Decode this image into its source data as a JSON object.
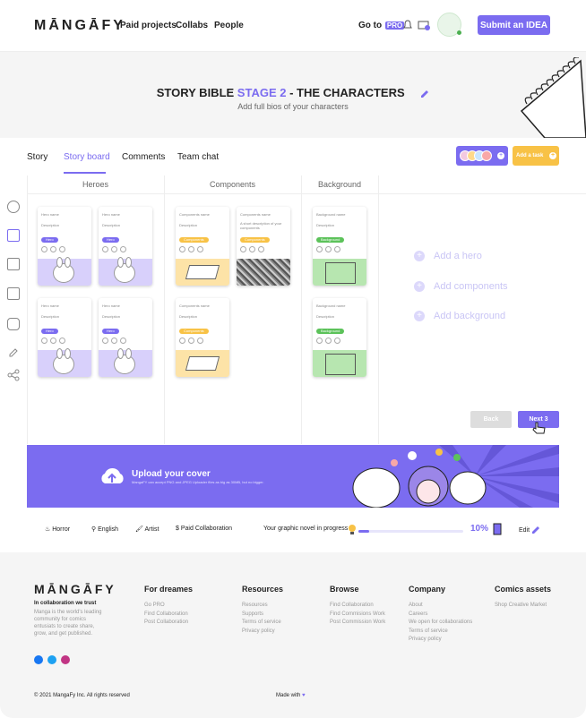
{
  "header": {
    "logo": "MĀNGĀFY",
    "nav": [
      "Paid projects",
      "Collabs",
      "People"
    ],
    "go_to": "Go to",
    "pro": "PRO",
    "submit": "Submit an IDEA"
  },
  "hero": {
    "title_a": "STORY BIBLE ",
    "title_stage": "STAGE 2",
    "title_b": " - THE CHARACTERS",
    "subtitle": "Add full bios of your characters"
  },
  "tabs": [
    "Story",
    "Story board",
    "Comments",
    "Team chat"
  ],
  "add_task": "Add a task",
  "board": {
    "columns": [
      "Heroes",
      "Components",
      "Background"
    ],
    "hero_card": {
      "name": "Hero name",
      "desc": "Description",
      "badge": "Hero"
    },
    "comp_card": {
      "name": "Components name",
      "desc": "Description",
      "desc2": "A short description of your components",
      "badge": "Components"
    },
    "bg_card": {
      "name": "Background name",
      "desc": "Description",
      "badge": "Background"
    },
    "add": [
      "Add a hero",
      "Add components",
      "Add background"
    ],
    "back": "Back",
    "next": "Next 3"
  },
  "banner": {
    "title": "Upload your cover",
    "sub": "MangaFY can accept PNG and JPEG Uploader files as big as 30MB, but no bigger."
  },
  "info": {
    "genre": "Horror",
    "lang": "English",
    "role": "Artist",
    "collab": "Paid Collaboration",
    "progress_label": "Your graphic novel in progress",
    "progress": 0.1,
    "progress_text": "10%",
    "edit": "Edit"
  },
  "footer": {
    "logo": "MĀNGĀFY",
    "trust": "In collaboration we trust",
    "trust_desc": "Manga is the world's leading community for comics entusiats to create share, grow, and get published.",
    "cols": [
      {
        "h": "For dreames",
        "l": [
          "Go PRO",
          "Find Collaboration",
          "Post Collaboration"
        ]
      },
      {
        "h": "Resources",
        "l": [
          "Resources",
          "Supports",
          "Terms of service",
          "Privacy policy"
        ]
      },
      {
        "h": "Browse",
        "l": [
          "Find Collaboration",
          "Find Commisions Work",
          "Post Commission Work"
        ]
      },
      {
        "h": "Company",
        "l": [
          "About",
          "Careers",
          "We open for collaborations",
          "Terms of service",
          "Privacy policy"
        ]
      },
      {
        "h": "Comics assets",
        "l": [
          "Shop Creative Market"
        ]
      }
    ],
    "copyright": "© 2021 MangaFy Inc. All rights reserved",
    "made": "Made with"
  },
  "colors": {
    "accent": "#7b6cf0",
    "yellow": "#f8c246",
    "green": "#5cc25a"
  }
}
